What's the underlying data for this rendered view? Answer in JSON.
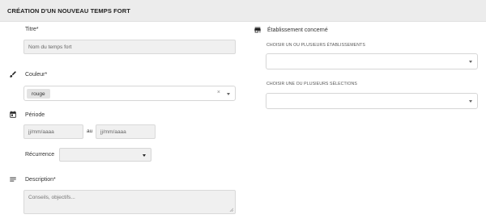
{
  "header": {
    "title": "CRÉATION D'UN NOUVEAU TEMPS FORT"
  },
  "titre": {
    "label": "Titre*",
    "placeholder": "Nom du temps fort"
  },
  "couleur": {
    "label": "Couleur*",
    "selected": "rouge",
    "clear": "×"
  },
  "periode": {
    "label": "Période",
    "start_placeholder": "jj/mm/aaaa",
    "separator": "au",
    "end_placeholder": "jj/mm/aaaa",
    "recurrence_label": "Récurrence",
    "recurrence_value": ""
  },
  "description": {
    "label": "Description*",
    "placeholder": "Conseils, objectifs..."
  },
  "etablissement": {
    "label": "Établissement concerné",
    "etablissements_label": "CHOISIR UN OU PLUSIEURS ÉTABLISSEMENTS",
    "selections_label": "CHOISIR UNE OU PLUSIEURS SÉLECTIONS"
  },
  "icons": {
    "couleur": "brush-icon",
    "periode": "calendar-icon",
    "description": "notes-icon",
    "etablissement": "store-icon"
  }
}
